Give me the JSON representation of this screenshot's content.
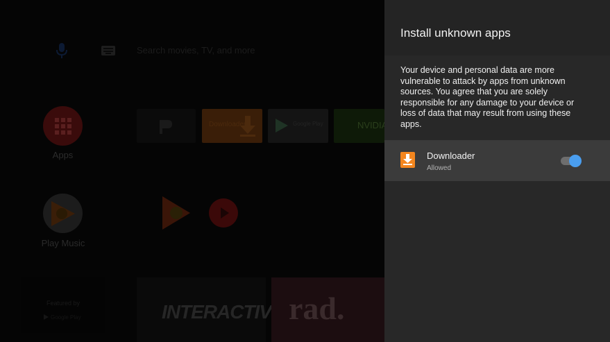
{
  "launcher": {
    "search_placeholder": "Search movies, TV, and more",
    "apps_label": "Apps",
    "music_label": "Play Music",
    "featured_by": "Featured by",
    "featured_store": "Google Play",
    "tiles": {
      "downloader_text": "Downloader",
      "google_play_text": "Google Play",
      "nvidia_text": "NVIDIA"
    },
    "banners": {
      "interactive": "INTERACTIVE",
      "rad": "rad."
    }
  },
  "panel": {
    "title": "Install unknown apps",
    "description": "Your device and personal data are more vulnerable to attack by apps from unknown sources. You agree that you are solely responsible for any damage to your device or loss of data that may result from using these apps.",
    "apps": [
      {
        "name": "Downloader",
        "status": "Allowed",
        "enabled": true,
        "icon": "downloader-app-icon"
      }
    ]
  },
  "colors": {
    "panel_bg": "#282828",
    "selected_row": "#3b3b3b",
    "toggle_on": "#4a9eef",
    "downloader_orange": "#f3861f"
  }
}
